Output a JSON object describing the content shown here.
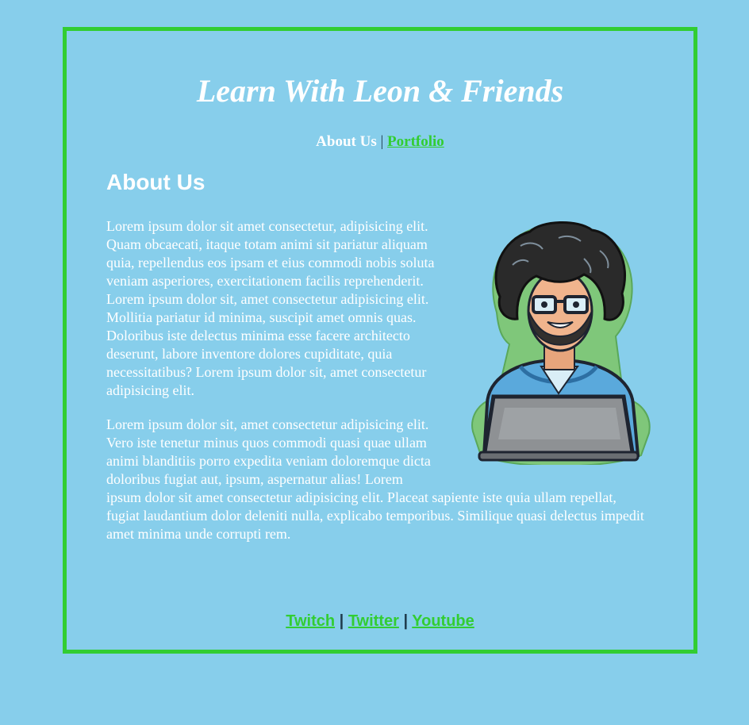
{
  "header": {
    "title": "Learn With Leon & Friends",
    "nav": {
      "current": "About Us",
      "separator": "|",
      "portfolio": "Portfolio"
    }
  },
  "main": {
    "heading": "About Us",
    "paragraphs": [
      "Lorem ipsum dolor sit amet consectetur, adipisicing elit. Quam obcaecati, itaque totam animi sit pariatur aliquam quia, repellendus eos ipsam et eius commodi nobis soluta veniam asperiores, exercitationem facilis reprehenderit. Lorem ipsum dolor sit, amet consectetur adipisicing elit. Mollitia pariatur id minima, suscipit amet omnis quas. Doloribus iste delectus minima esse facere architecto deserunt, labore inventore dolores cupiditate, quia necessitatibus? Lorem ipsum dolor sit, amet consectetur adipisicing elit.",
      "Lorem ipsum dolor sit, amet consectetur adipisicing elit. Vero iste tenetur minus quos commodi quasi quae ullam animi blanditiis porro expedita veniam doloremque dicta doloribus fugiat aut, ipsum, aspernatur alias! Lorem ipsum dolor sit amet consectetur adipisicing elit. Placeat sapiente iste quia ullam repellat, fugiat laudantium dolor deleniti nulla, explicabo temporibus. Similique quasi delectus impedit amet minima unde corrupti rem."
    ]
  },
  "footer": {
    "links": [
      "Twitch",
      "Twitter",
      "Youtube"
    ],
    "separator": "|"
  },
  "colors": {
    "background": "#87ceeb",
    "border": "#32cd32",
    "link": "#32cd32",
    "text": "#ffffff"
  },
  "icons": {
    "avatar": "cartoon-developer-with-laptop"
  }
}
